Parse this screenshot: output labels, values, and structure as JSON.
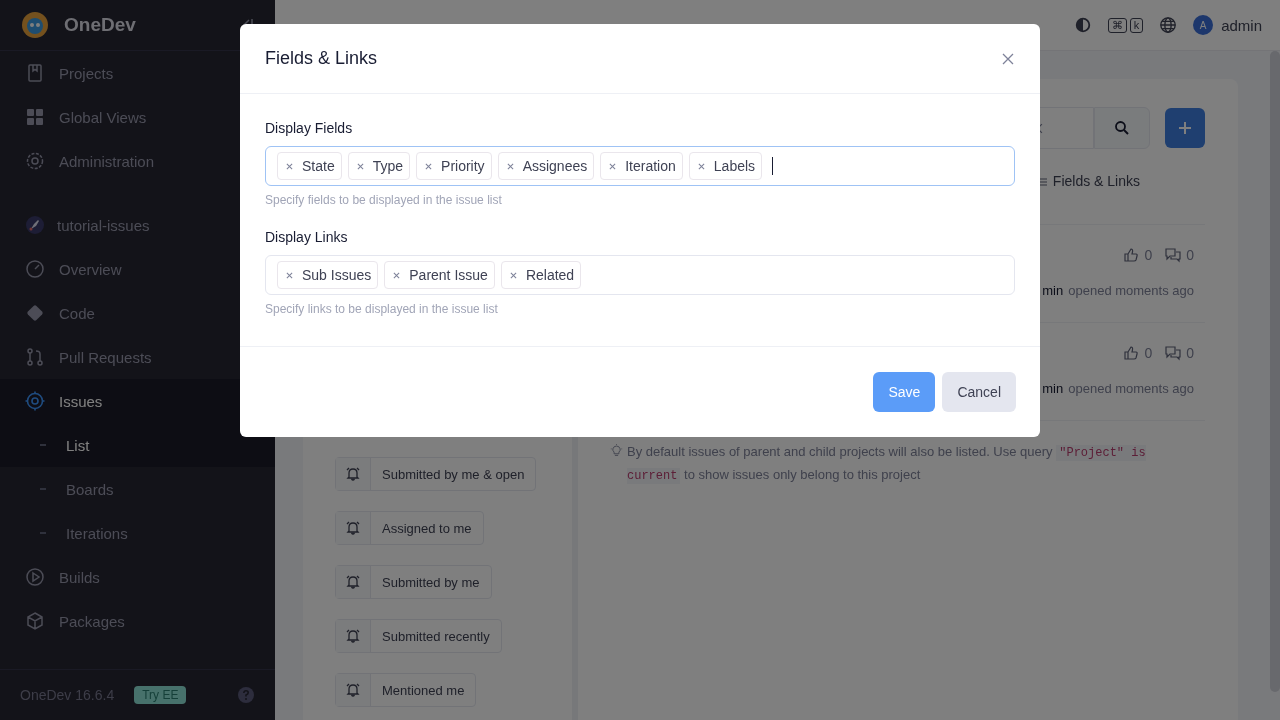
{
  "sidebar": {
    "brand": "OneDev",
    "nav": [
      {
        "label": "Projects"
      },
      {
        "label": "Global Views"
      },
      {
        "label": "Administration"
      }
    ],
    "project": {
      "name": "tutorial-issues"
    },
    "project_nav": [
      {
        "label": "Overview",
        "selected": false
      },
      {
        "label": "Code",
        "selected": false
      },
      {
        "label": "Pull Requests",
        "selected": false
      },
      {
        "label": "Issues",
        "selected": true,
        "children": [
          {
            "label": "List",
            "selected": true
          },
          {
            "label": "Boards",
            "selected": false
          },
          {
            "label": "Iterations",
            "selected": false
          }
        ]
      },
      {
        "label": "Builds",
        "selected": false
      },
      {
        "label": "Packages",
        "selected": false
      }
    ],
    "version": "OneDev 16.6.4",
    "badge": "Try EE"
  },
  "topbar": {
    "shortcut_keys": [
      "⌘",
      "k"
    ],
    "avatar_initial": "A",
    "user": "admin"
  },
  "saved_queries": [
    "Submitted by me & open",
    "Assigned to me",
    "Submitted by me",
    "Submitted recently",
    "Mentioned me"
  ],
  "issues": {
    "fields_links_link": "Fields & Links",
    "rows": [
      {
        "votes": "0",
        "comments": "0",
        "author": "min",
        "action": "opened moments ago"
      },
      {
        "votes": "0",
        "comments": "0",
        "author": "min",
        "action": "opened moments ago"
      }
    ],
    "tip": {
      "before": "By default issues of parent and child projects will also be listed. Use query",
      "code": "\"Project\" is current",
      "after": "to show issues only belong to this project"
    }
  },
  "modal": {
    "title": "Fields & Links",
    "sections": [
      {
        "label": "Display Fields",
        "focused": true,
        "chips": [
          "State",
          "Type",
          "Priority",
          "Assignees",
          "Iteration",
          "Labels"
        ],
        "help": "Specify fields to be displayed in the issue list"
      },
      {
        "label": "Display Links",
        "focused": false,
        "chips": [
          "Sub Issues",
          "Parent Issue",
          "Related"
        ],
        "help": "Specify links to be displayed in the issue list"
      }
    ],
    "buttons": [
      {
        "label": "Save",
        "kind": "primary"
      },
      {
        "label": "Cancel",
        "kind": "secondary"
      }
    ]
  }
}
